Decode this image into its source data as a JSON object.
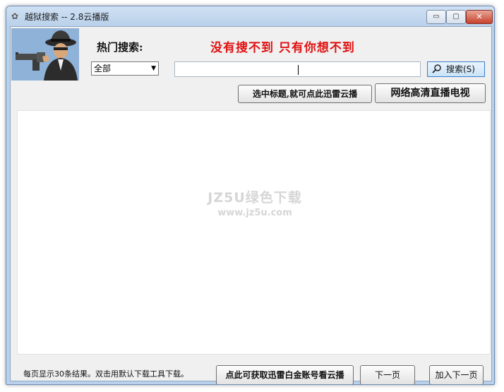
{
  "window": {
    "title": "越狱搜索 -- 2.8云播版",
    "controls": {
      "minimize": "▭",
      "maximize": "▢",
      "close": "✕"
    }
  },
  "header": {
    "hot_label": "热门搜索:",
    "slogan": "没有搜不到  只有你想不到"
  },
  "search": {
    "category": "全部",
    "value": "",
    "button_label": "搜索(S)"
  },
  "actions": {
    "xunlei_title": "选中标题,就可点此迅雷云播",
    "tv": "网络高清直播电视"
  },
  "results": {
    "watermark_line1": "JZ5U绿色下载",
    "watermark_line2": "www.jz5u.com"
  },
  "footer": {
    "info": "每页显示30条结果。双击用默认下载工具下载。",
    "account_button": "点此可获取迅雷白金账号看云播",
    "next_button": "下一页",
    "add_next_button": "加入下一页"
  },
  "colors": {
    "slogan": "#e01010",
    "title_bar": "#b9d1ea",
    "close_button": "#c7422c"
  },
  "icons": {
    "app": "app-icon",
    "logo": "detective-gun-logo",
    "search": "search-icon",
    "dropdown": "chevron-down-icon"
  }
}
